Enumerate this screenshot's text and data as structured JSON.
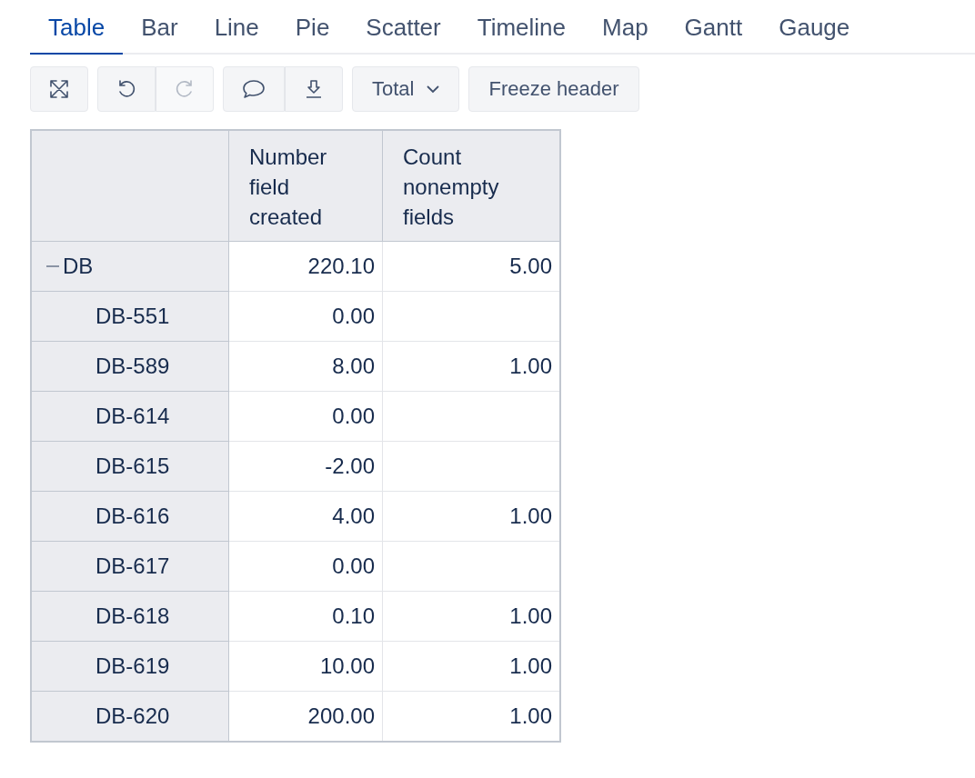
{
  "tabs": [
    {
      "label": "Table",
      "selected": true
    },
    {
      "label": "Bar",
      "selected": false
    },
    {
      "label": "Line",
      "selected": false
    },
    {
      "label": "Pie",
      "selected": false
    },
    {
      "label": "Scatter",
      "selected": false
    },
    {
      "label": "Timeline",
      "selected": false
    },
    {
      "label": "Map",
      "selected": false
    },
    {
      "label": "Gantt",
      "selected": false
    },
    {
      "label": "Gauge",
      "selected": false
    }
  ],
  "toolbar": {
    "groups": [
      [
        {
          "kind": "expand",
          "disabled": false
        }
      ],
      [
        {
          "kind": "undo",
          "disabled": false
        },
        {
          "kind": "redo",
          "disabled": true
        }
      ],
      [
        {
          "kind": "comment",
          "disabled": false
        },
        {
          "kind": "download",
          "disabled": false
        }
      ]
    ],
    "total_dropdown": {
      "label": "Total"
    },
    "freeze_button": {
      "label": "Freeze header"
    }
  },
  "table": {
    "columns": [
      "Number field created",
      "Count nonempty fields"
    ],
    "rows": [
      {
        "label": "DB",
        "expanded": true,
        "number_field_created": "220.10",
        "count_nonempty_fields": "5.00",
        "children": [
          {
            "label": "DB-551",
            "number_field_created": "0.00"
          },
          {
            "label": "DB-589",
            "number_field_created": "8.00",
            "count_nonempty_fields": "1.00"
          },
          {
            "label": "DB-614",
            "number_field_created": "0.00"
          },
          {
            "label": "DB-615",
            "number_field_created": "-2.00"
          },
          {
            "label": "DB-616",
            "number_field_created": "4.00",
            "count_nonempty_fields": "1.00"
          },
          {
            "label": "DB-617",
            "number_field_created": "0.00"
          },
          {
            "label": "DB-618",
            "number_field_created": "0.10",
            "count_nonempty_fields": "1.00"
          },
          {
            "label": "DB-619",
            "number_field_created": "10.00",
            "count_nonempty_fields": "1.00"
          },
          {
            "label": "DB-620",
            "number_field_created": "200.00",
            "count_nonempty_fields": "1.00"
          }
        ]
      }
    ]
  }
}
